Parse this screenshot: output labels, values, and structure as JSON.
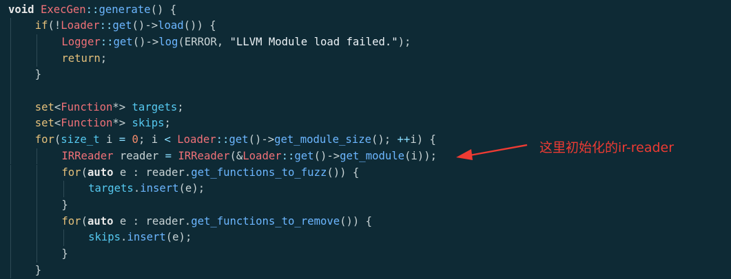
{
  "code": {
    "lines": [
      {
        "indent": 0,
        "tokens": [
          {
            "t": "void",
            "c": "bold"
          },
          {
            "t": " ",
            "c": "plain"
          },
          {
            "t": "ExecGen",
            "c": "type"
          },
          {
            "t": "::",
            "c": "op"
          },
          {
            "t": "generate",
            "c": "fn"
          },
          {
            "t": "() {",
            "c": "plain"
          }
        ]
      },
      {
        "indent": 1,
        "tokens": [
          {
            "t": "if",
            "c": "kw"
          },
          {
            "t": "(!",
            "c": "plain"
          },
          {
            "t": "Loader",
            "c": "type"
          },
          {
            "t": "::",
            "c": "op"
          },
          {
            "t": "get",
            "c": "fn"
          },
          {
            "t": "()->",
            "c": "plain"
          },
          {
            "t": "load",
            "c": "fn"
          },
          {
            "t": "()) {",
            "c": "plain"
          }
        ]
      },
      {
        "indent": 2,
        "tokens": [
          {
            "t": "Logger",
            "c": "type"
          },
          {
            "t": "::",
            "c": "op"
          },
          {
            "t": "get",
            "c": "fn"
          },
          {
            "t": "()->",
            "c": "plain"
          },
          {
            "t": "log",
            "c": "fn"
          },
          {
            "t": "(ERROR, ",
            "c": "plain"
          },
          {
            "t": "\"LLVM Module load failed.\"",
            "c": "str"
          },
          {
            "t": ");",
            "c": "plain"
          }
        ]
      },
      {
        "indent": 2,
        "tokens": [
          {
            "t": "return",
            "c": "kw"
          },
          {
            "t": ";",
            "c": "plain"
          }
        ]
      },
      {
        "indent": 1,
        "tokens": [
          {
            "t": "}",
            "c": "plain"
          }
        ]
      },
      {
        "indent": 1,
        "tokens": []
      },
      {
        "indent": 1,
        "tokens": [
          {
            "t": "set",
            "c": "kw"
          },
          {
            "t": "<",
            "c": "plain"
          },
          {
            "t": "Function",
            "c": "type"
          },
          {
            "t": "*> ",
            "c": "plain"
          },
          {
            "t": "targets",
            "c": "var"
          },
          {
            "t": ";",
            "c": "plain"
          }
        ]
      },
      {
        "indent": 1,
        "tokens": [
          {
            "t": "set",
            "c": "kw"
          },
          {
            "t": "<",
            "c": "plain"
          },
          {
            "t": "Function",
            "c": "type"
          },
          {
            "t": "*> ",
            "c": "plain"
          },
          {
            "t": "skips",
            "c": "var"
          },
          {
            "t": ";",
            "c": "plain"
          }
        ]
      },
      {
        "indent": 1,
        "tokens": [
          {
            "t": "for",
            "c": "kw"
          },
          {
            "t": "(",
            "c": "plain"
          },
          {
            "t": "size_t",
            "c": "var"
          },
          {
            "t": " i ",
            "c": "plain"
          },
          {
            "t": "=",
            "c": "op"
          },
          {
            "t": " ",
            "c": "plain"
          },
          {
            "t": "0",
            "c": "num"
          },
          {
            "t": "; i ",
            "c": "plain"
          },
          {
            "t": "<",
            "c": "op"
          },
          {
            "t": " ",
            "c": "plain"
          },
          {
            "t": "Loader",
            "c": "type"
          },
          {
            "t": "::",
            "c": "op"
          },
          {
            "t": "get",
            "c": "fn"
          },
          {
            "t": "()->",
            "c": "plain"
          },
          {
            "t": "get_module_size",
            "c": "fn"
          },
          {
            "t": "(); ",
            "c": "plain"
          },
          {
            "t": "++",
            "c": "op"
          },
          {
            "t": "i) {",
            "c": "plain"
          }
        ]
      },
      {
        "indent": 2,
        "tokens": [
          {
            "t": "IRReader",
            "c": "type"
          },
          {
            "t": " reader ",
            "c": "plain"
          },
          {
            "t": "=",
            "c": "op"
          },
          {
            "t": " ",
            "c": "plain"
          },
          {
            "t": "IRReader",
            "c": "type"
          },
          {
            "t": "(&",
            "c": "plain"
          },
          {
            "t": "Loader",
            "c": "type"
          },
          {
            "t": "::",
            "c": "op"
          },
          {
            "t": "get",
            "c": "fn"
          },
          {
            "t": "()->",
            "c": "plain"
          },
          {
            "t": "get_module",
            "c": "fn"
          },
          {
            "t": "(i));",
            "c": "plain"
          }
        ]
      },
      {
        "indent": 2,
        "tokens": [
          {
            "t": "for",
            "c": "kw"
          },
          {
            "t": "(",
            "c": "plain"
          },
          {
            "t": "auto",
            "c": "bold"
          },
          {
            "t": " e : reader.",
            "c": "plain"
          },
          {
            "t": "get_functions_to_fuzz",
            "c": "fn"
          },
          {
            "t": "()) {",
            "c": "plain"
          }
        ]
      },
      {
        "indent": 3,
        "tokens": [
          {
            "t": "targets",
            "c": "var"
          },
          {
            "t": ".",
            "c": "plain"
          },
          {
            "t": "insert",
            "c": "fn"
          },
          {
            "t": "(e);",
            "c": "plain"
          }
        ]
      },
      {
        "indent": 2,
        "tokens": [
          {
            "t": "}",
            "c": "plain"
          }
        ]
      },
      {
        "indent": 2,
        "tokens": [
          {
            "t": "for",
            "c": "kw"
          },
          {
            "t": "(",
            "c": "plain"
          },
          {
            "t": "auto",
            "c": "bold"
          },
          {
            "t": " e : reader.",
            "c": "plain"
          },
          {
            "t": "get_functions_to_remove",
            "c": "fn"
          },
          {
            "t": "()) {",
            "c": "plain"
          }
        ]
      },
      {
        "indent": 3,
        "tokens": [
          {
            "t": "skips",
            "c": "var"
          },
          {
            "t": ".",
            "c": "plain"
          },
          {
            "t": "insert",
            "c": "fn"
          },
          {
            "t": "(e);",
            "c": "plain"
          }
        ]
      },
      {
        "indent": 2,
        "tokens": [
          {
            "t": "}",
            "c": "plain"
          }
        ]
      },
      {
        "indent": 1,
        "tokens": [
          {
            "t": "}",
            "c": "plain"
          }
        ]
      }
    ]
  },
  "annotation": {
    "text": "这里初始化的ir-reader",
    "color": "#ee3b33",
    "points_to_line": 10
  },
  "theme": {
    "background": "#0e2a35",
    "indent_guide": "#2f4b56"
  }
}
